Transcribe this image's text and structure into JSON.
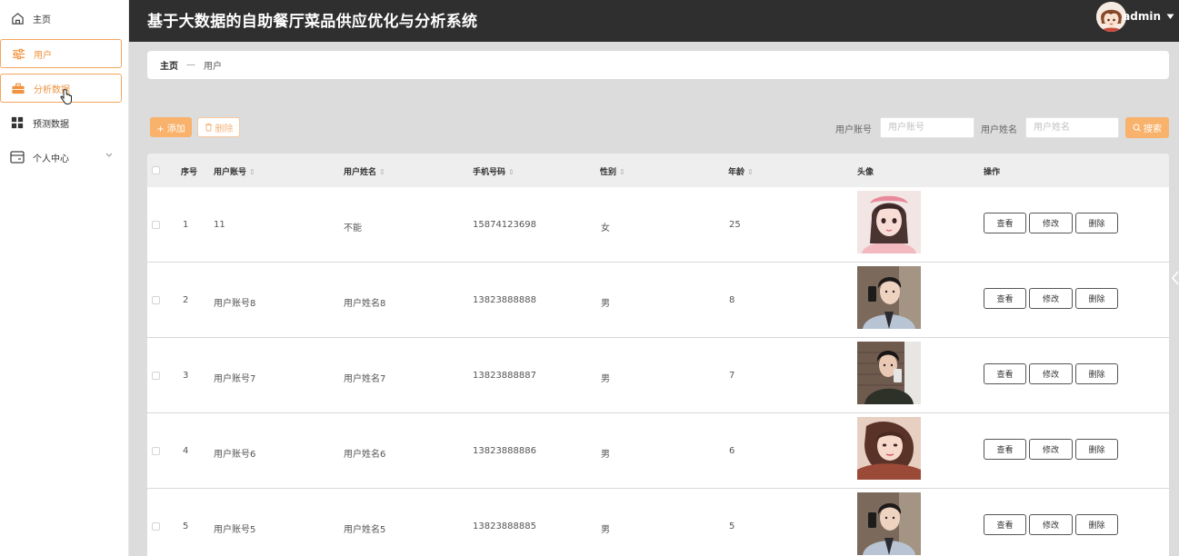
{
  "header": {
    "title": "基于大数据的自助餐厅菜品供应优化与分析系统",
    "user_name": "admin"
  },
  "sidebar": {
    "items": [
      {
        "label": "主页",
        "icon": "home-icon"
      },
      {
        "label": "用户",
        "icon": "sliders-icon",
        "active": true
      },
      {
        "label": "分析数据",
        "icon": "briefcase-icon",
        "active": true
      },
      {
        "label": "预测数据",
        "icon": "grid-icon"
      },
      {
        "label": "个人中心",
        "icon": "card-icon",
        "has_children": true
      }
    ]
  },
  "breadcrumb": {
    "home": "主页",
    "separator": "—",
    "current": "用户"
  },
  "toolbar": {
    "add_label": "+ 添加",
    "delete_label": "删除",
    "account_label": "用户账号",
    "account_placeholder": "用户账号",
    "name_label": "用户姓名",
    "name_placeholder": "用户姓名",
    "search_label": "搜索"
  },
  "table": {
    "columns": [
      "序号",
      "用户账号",
      "用户姓名",
      "手机号码",
      "性别",
      "年龄",
      "头像",
      "操作"
    ],
    "rows": [
      {
        "index": "1",
        "account": "11",
        "name": "不能",
        "phone": "15874123698",
        "gender": "女",
        "age": "25"
      },
      {
        "index": "2",
        "account": "用户账号8",
        "name": "用户姓名8",
        "phone": "13823888888",
        "gender": "男",
        "age": "8"
      },
      {
        "index": "3",
        "account": "用户账号7",
        "name": "用户姓名7",
        "phone": "13823888887",
        "gender": "男",
        "age": "7"
      },
      {
        "index": "4",
        "account": "用户账号6",
        "name": "用户姓名6",
        "phone": "13823888886",
        "gender": "男",
        "age": "6"
      },
      {
        "index": "5",
        "account": "用户账号5",
        "name": "用户姓名5",
        "phone": "13823888885",
        "gender": "男",
        "age": "5"
      }
    ],
    "actions": {
      "view": "查看",
      "edit": "修改",
      "delete": "删除"
    }
  },
  "colors": {
    "accent": "#f8b26c",
    "header_bg": "#2e2f2e",
    "active_border": "#f5a55c"
  }
}
